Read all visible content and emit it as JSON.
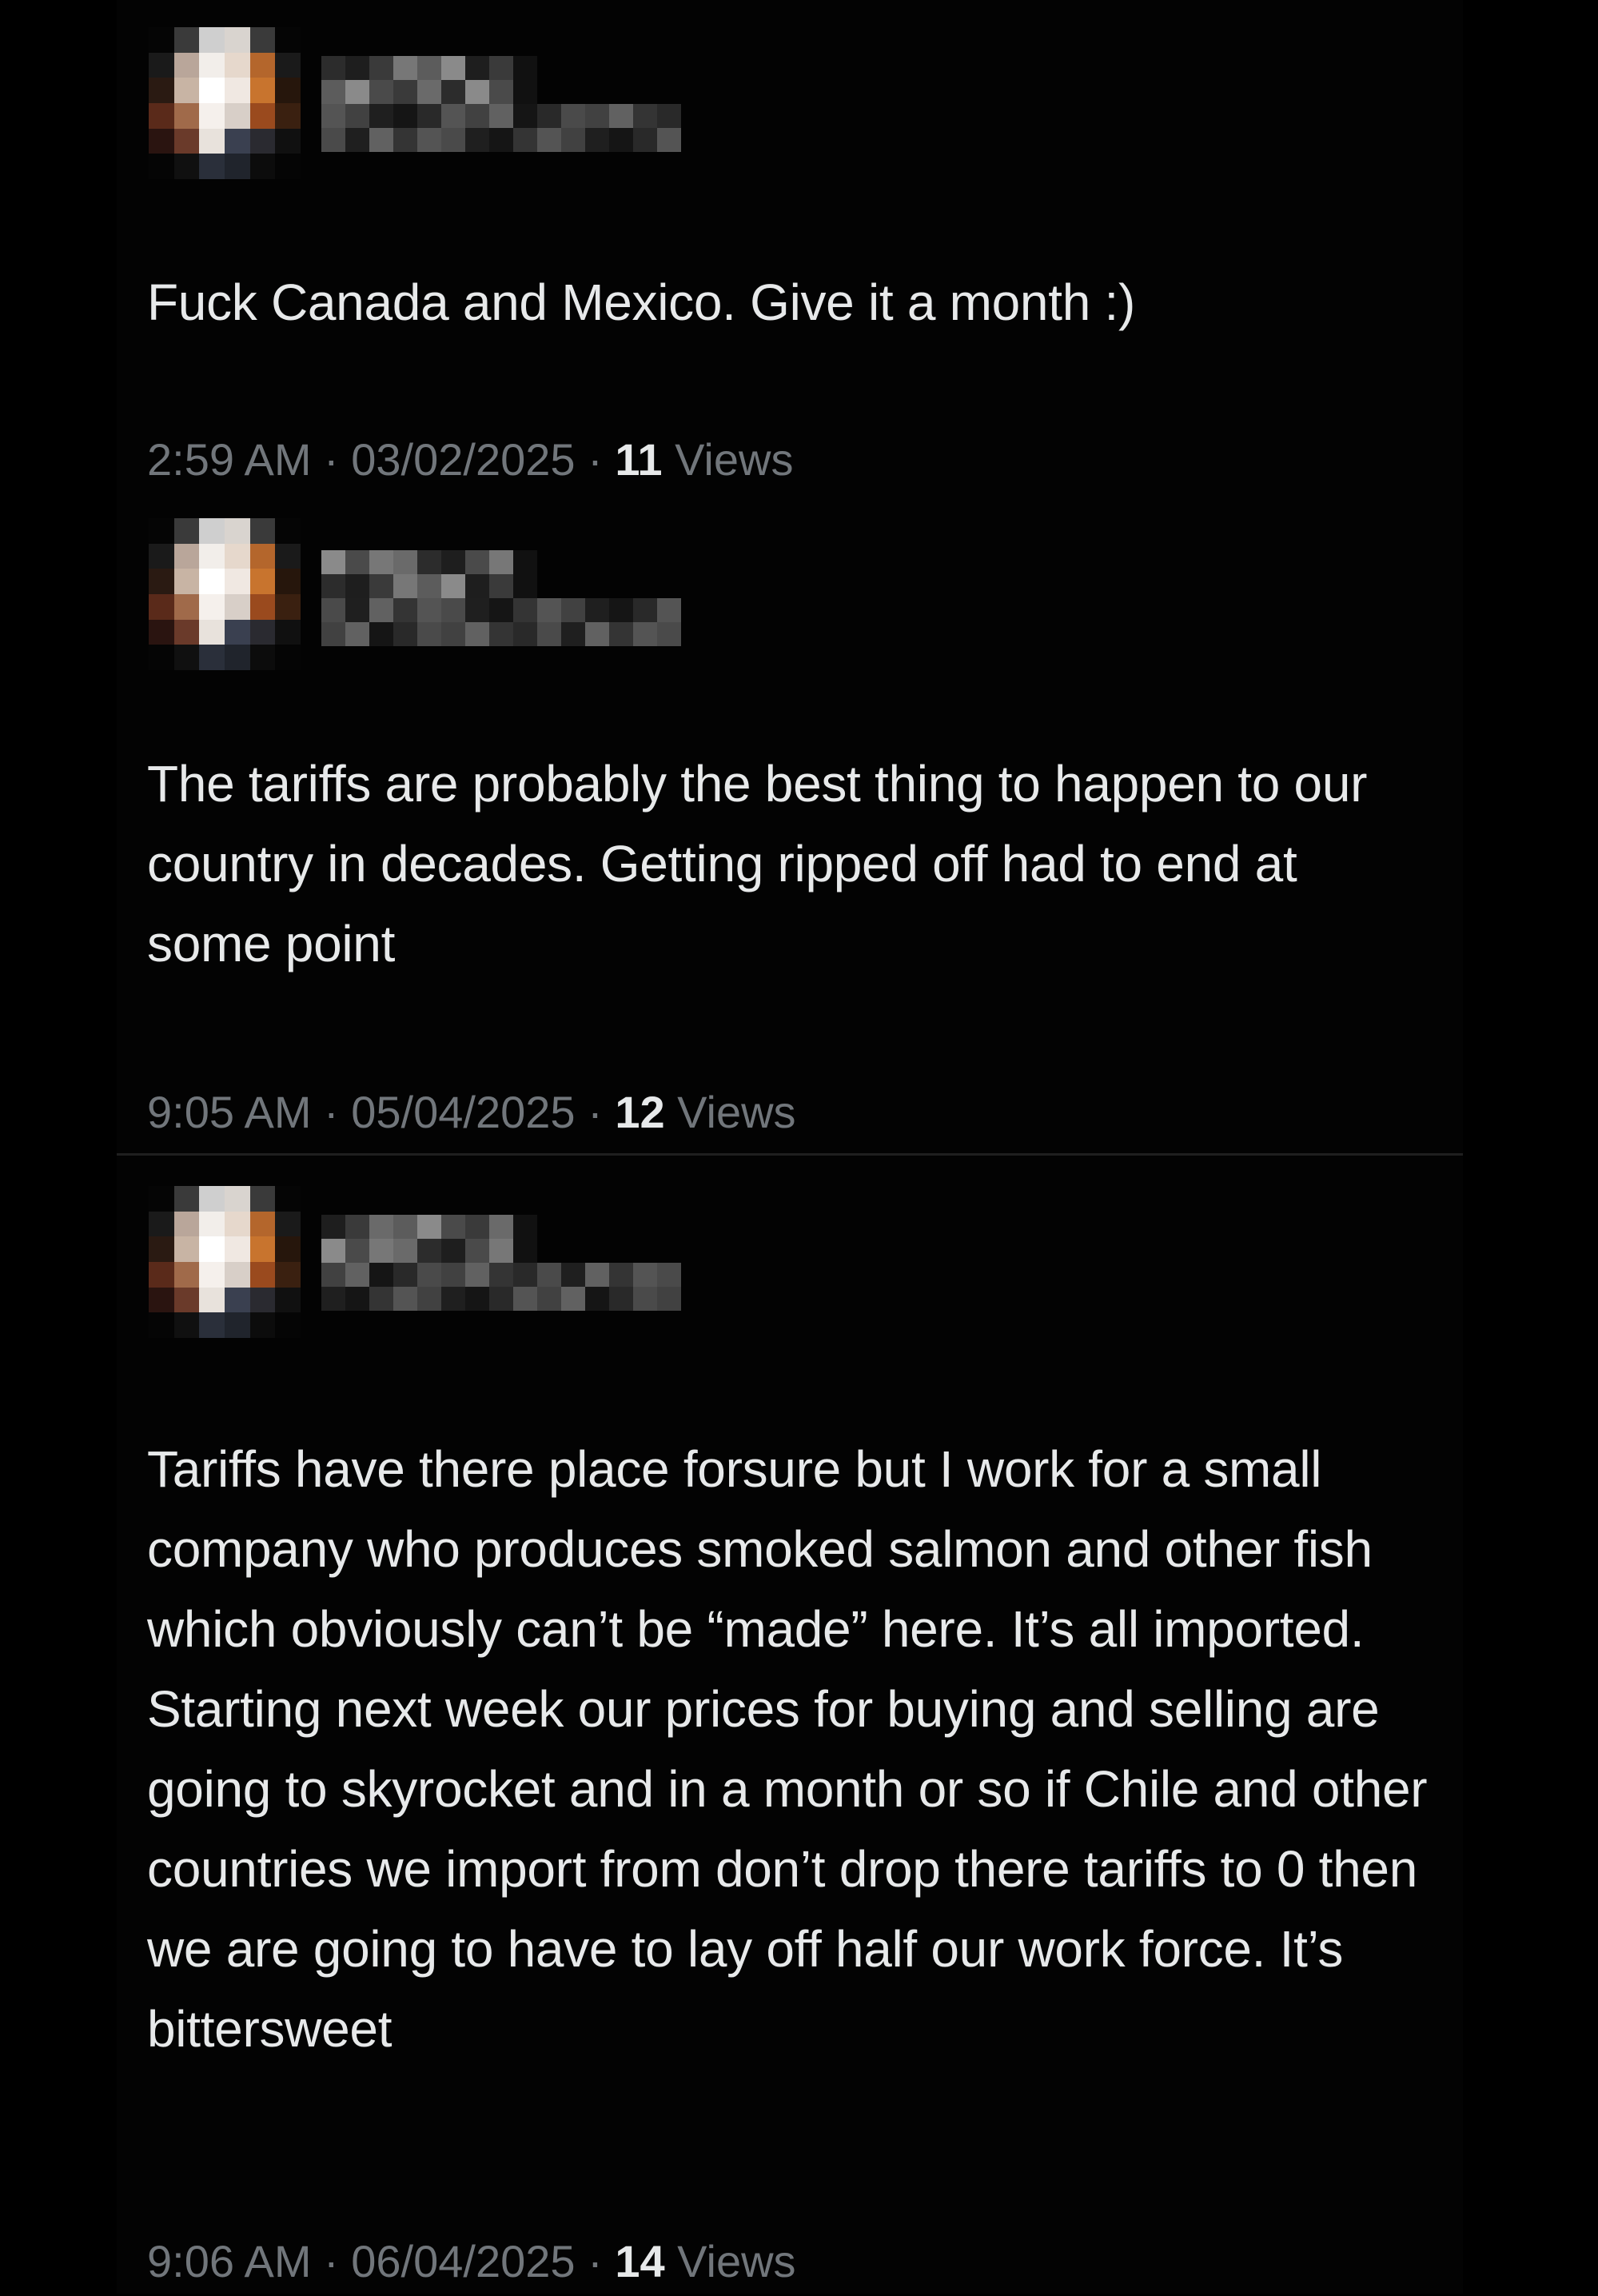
{
  "tweets": [
    {
      "text": "Fuck Canada and Mexico. Give it a month :)",
      "time": "2:59 AM",
      "date": "03/02/2025",
      "views_count": "11",
      "views_label": "Views"
    },
    {
      "text": "The tariffs are probably the best thing to happen to our country in decades. Getting ripped off had to end at some point",
      "time": "9:05 AM",
      "date": "05/04/2025",
      "views_count": "12",
      "views_label": "Views"
    },
    {
      "text": "Tariffs have there place forsure but I work for a small company who produces smoked salmon and other fish which obviously can’t be “made” here. It’s all imported. Starting next week our prices for buying and selling are going to skyrocket and in a month or so if Chile and other countries we import from don’t drop there tariffs to 0 then we are going to have to lay off half our work force. It’s bittersweet",
      "time": "9:06 AM",
      "date": "06/04/2025",
      "views_count": "14",
      "views_label": "Views"
    }
  ],
  "colors": {
    "background": "#000000",
    "text": "#e7e9ea",
    "meta": "#71767b"
  }
}
